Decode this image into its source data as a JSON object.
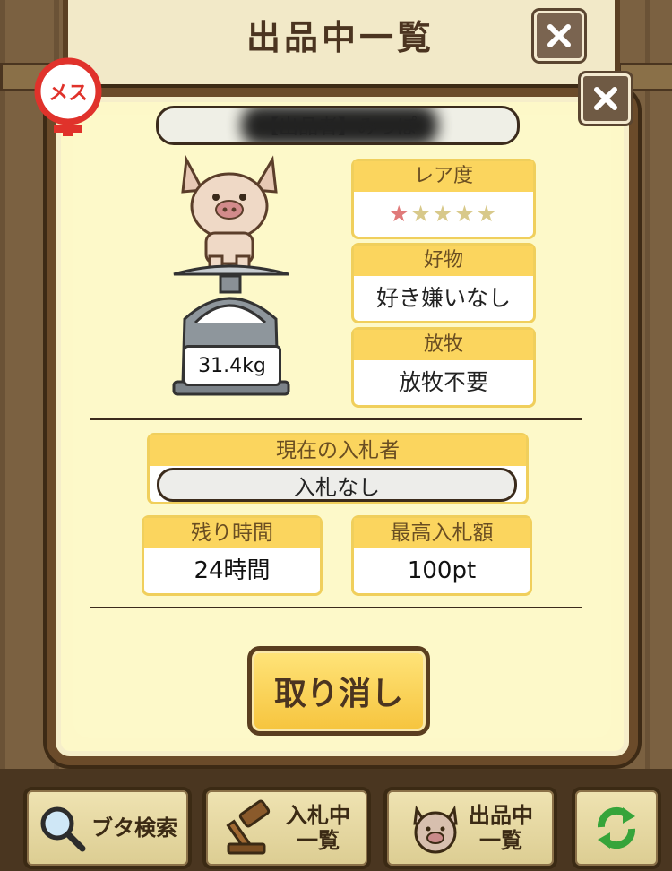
{
  "screen": {
    "title": "出品中一覧"
  },
  "listing": {
    "gender": "メス",
    "name_bar": "【出品者】みっぽ",
    "weight": "31.4kg",
    "rarity": {
      "label": "レア度",
      "stars_filled": 1,
      "stars_total": 5,
      "filled_color": "#e07a7a",
      "empty_color": "#d8c98a"
    },
    "favorite": {
      "label": "好物",
      "value": "好き嫌いなし"
    },
    "grazing": {
      "label": "放牧",
      "value": "放牧不要"
    },
    "current_bidder": {
      "label": "現在の入札者",
      "value": "入札なし"
    },
    "time_left": {
      "label": "残り時間",
      "value": "24時間"
    },
    "top_bid": {
      "label": "最高入札額",
      "value": "100pt"
    },
    "cancel_label": "取り消し"
  },
  "footer": {
    "search_label": "ブタ検索",
    "bidding_label": "入札中\n一覧",
    "listing_label": "出品中\n一覧"
  },
  "icons": {
    "close": "close-icon",
    "gender": "female-icon",
    "search": "magnifier-icon",
    "gavel": "gavel-icon",
    "pig": "pig-face-icon",
    "refresh": "refresh-icon"
  },
  "colors": {
    "accent": "#fbd55e",
    "panel": "#fdf8c8",
    "frame": "#6b4b2a",
    "gender_red": "#e0322b"
  }
}
